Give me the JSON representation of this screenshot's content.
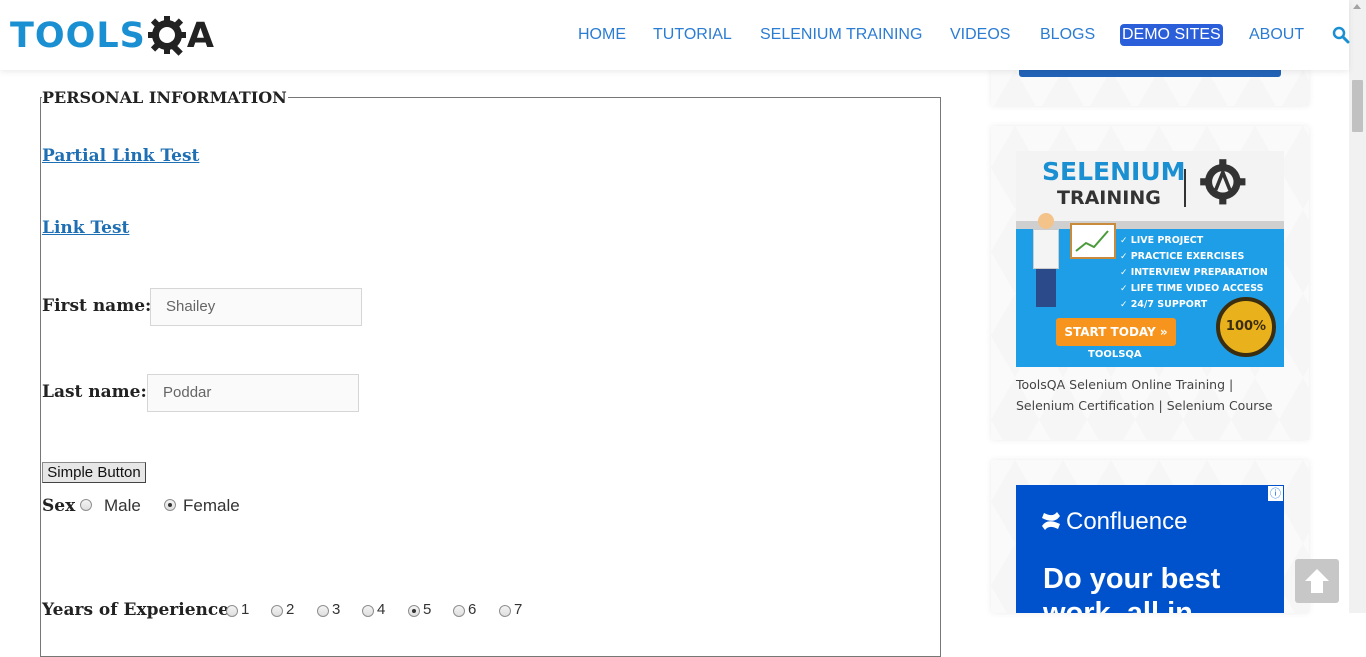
{
  "header": {
    "logo_text_part1": "TOOLS",
    "logo_text_part2": "A",
    "nav": [
      {
        "label": "HOME"
      },
      {
        "label": "TUTORIAL"
      },
      {
        "label": "SELENIUM TRAINING"
      },
      {
        "label": "VIDEOS"
      },
      {
        "label": "BLOGS"
      },
      {
        "label": "DEMO SITES",
        "active": true
      },
      {
        "label": "ABOUT"
      }
    ],
    "search_icon": "search-icon",
    "accent_color": "#2b7cd3"
  },
  "form": {
    "legend": "PERSONAL INFORMATION",
    "partial_link": "Partial Link Test",
    "link_test": "Link Test",
    "first_name_label": "First name:",
    "first_name_value": "Shailey",
    "last_name_label": "Last name:",
    "last_name_value": "Poddar",
    "simple_button": "Simple Button",
    "sex_label": "Sex",
    "sex_options": [
      {
        "label": "Male",
        "checked": false
      },
      {
        "label": "Female",
        "checked": true
      }
    ],
    "experience_label": "Years of Experience",
    "experience_options": [
      {
        "label": "1",
        "checked": false
      },
      {
        "label": "2",
        "checked": false
      },
      {
        "label": "3",
        "checked": false
      },
      {
        "label": "4",
        "checked": false
      },
      {
        "label": "5",
        "checked": true
      },
      {
        "label": "6",
        "checked": false
      },
      {
        "label": "7",
        "checked": false
      }
    ]
  },
  "sidebar": {
    "banner": {
      "title1": "SELENIUM",
      "title2": "TRAINING",
      "features": [
        "LIVE PROJECT",
        "PRACTICE EXERCISES",
        "INTERVIEW PREPARATION",
        "LIFE TIME VIDEO ACCESS",
        "24/7 SUPPORT"
      ],
      "cta": "START TODAY »",
      "footer": "TOOLSQA",
      "seal": "100%"
    },
    "caption": "ToolsQA Selenium Online Training | Selenium Certification | Selenium Course",
    "ad": {
      "brand": "Confluence",
      "headline1": "Do your best",
      "headline2": "work, all in"
    }
  }
}
